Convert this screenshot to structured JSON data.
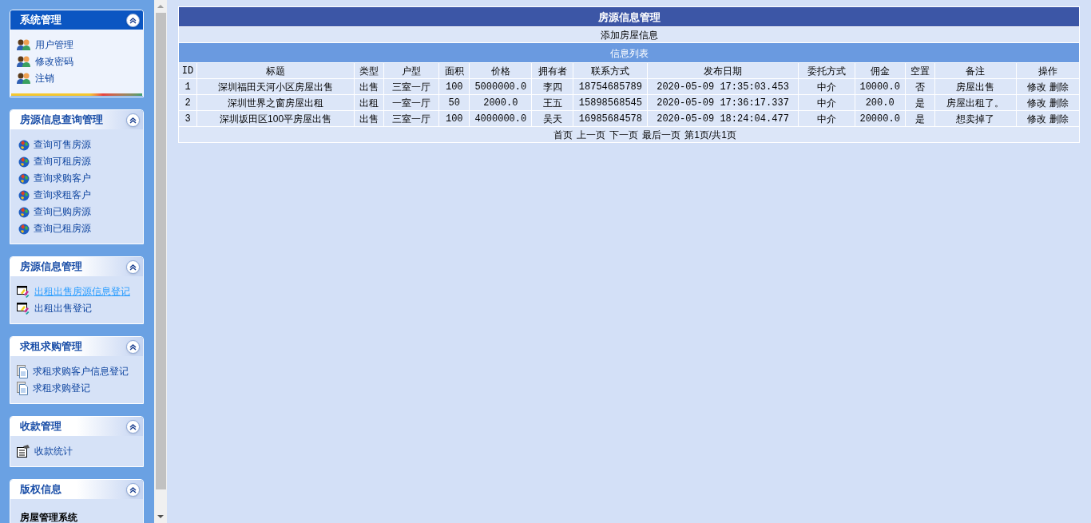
{
  "sidebar": {
    "panels": [
      {
        "title": "系统管理",
        "active": true,
        "expanded": true,
        "kind": "users",
        "items": [
          {
            "label": "用户管理",
            "selected": false
          },
          {
            "label": "修改密码",
            "selected": false
          },
          {
            "label": "注销",
            "selected": false
          }
        ]
      },
      {
        "title": "房源信息查询管理",
        "active": false,
        "expanded": true,
        "kind": "globe",
        "items": [
          {
            "label": "查询可售房源",
            "selected": false
          },
          {
            "label": "查询可租房源",
            "selected": false
          },
          {
            "label": "查询求购客户",
            "selected": false
          },
          {
            "label": "查询求租客户",
            "selected": false
          },
          {
            "label": "查询已购房源",
            "selected": false
          },
          {
            "label": "查询已租房源",
            "selected": false
          }
        ]
      },
      {
        "title": "房源信息管理",
        "active": false,
        "expanded": true,
        "kind": "edit",
        "items": [
          {
            "label": "出租出售房源信息登记",
            "selected": true
          },
          {
            "label": "出租出售登记",
            "selected": false
          }
        ]
      },
      {
        "title": "求租求购管理",
        "active": false,
        "expanded": true,
        "kind": "document",
        "items": [
          {
            "label": "求租求购客户信息登记",
            "selected": false
          },
          {
            "label": "求租求购登记",
            "selected": false
          }
        ]
      },
      {
        "title": "收款管理",
        "active": false,
        "expanded": true,
        "kind": "report",
        "items": [
          {
            "label": "收款统计",
            "selected": false
          }
        ]
      },
      {
        "title": "版权信息",
        "active": false,
        "expanded": true,
        "kind": "text",
        "text": "房屋管理系统"
      }
    ]
  },
  "table": {
    "title": "房源信息管理",
    "add_link": "添加房屋信息",
    "list_title": "信息列表",
    "columns": [
      "ID",
      "标题",
      "类型",
      "户型",
      "面积",
      "价格",
      "拥有者",
      "联系方式",
      "发布日期",
      "委托方式",
      "佣金",
      "空置",
      "备注",
      "操作"
    ],
    "rows": [
      {
        "cells": [
          "1",
          "深圳福田天河小区房屋出售",
          "出售",
          "三室一厅",
          "100",
          "5000000.0",
          "李四",
          "18754685789",
          "2020-05-09 17:35:03.453",
          "中介",
          "10000.0",
          "否",
          "房屋出售"
        ],
        "actions": [
          "修改",
          "删除"
        ]
      },
      {
        "cells": [
          "2",
          "深圳世界之窗房屋出租",
          "出租",
          "一室一厅",
          "50",
          "2000.0",
          "王五",
          "15898568545",
          "2020-05-09 17:36:17.337",
          "中介",
          "200.0",
          "是",
          "房屋出租了。"
        ],
        "actions": [
          "修改",
          "删除"
        ]
      },
      {
        "cells": [
          "3",
          "深圳坂田区100平房屋出售",
          "出售",
          "三室一厅",
          "100",
          "4000000.0",
          "吴天",
          "16985684578",
          "2020-05-09 18:24:04.477",
          "中介",
          "20000.0",
          "是",
          "想卖掉了"
        ],
        "actions": [
          "修改",
          "删除"
        ]
      }
    ],
    "pager": [
      "首页",
      "上一页",
      "下一页",
      "最后一页"
    ],
    "page_info": "第1页/共1页"
  }
}
